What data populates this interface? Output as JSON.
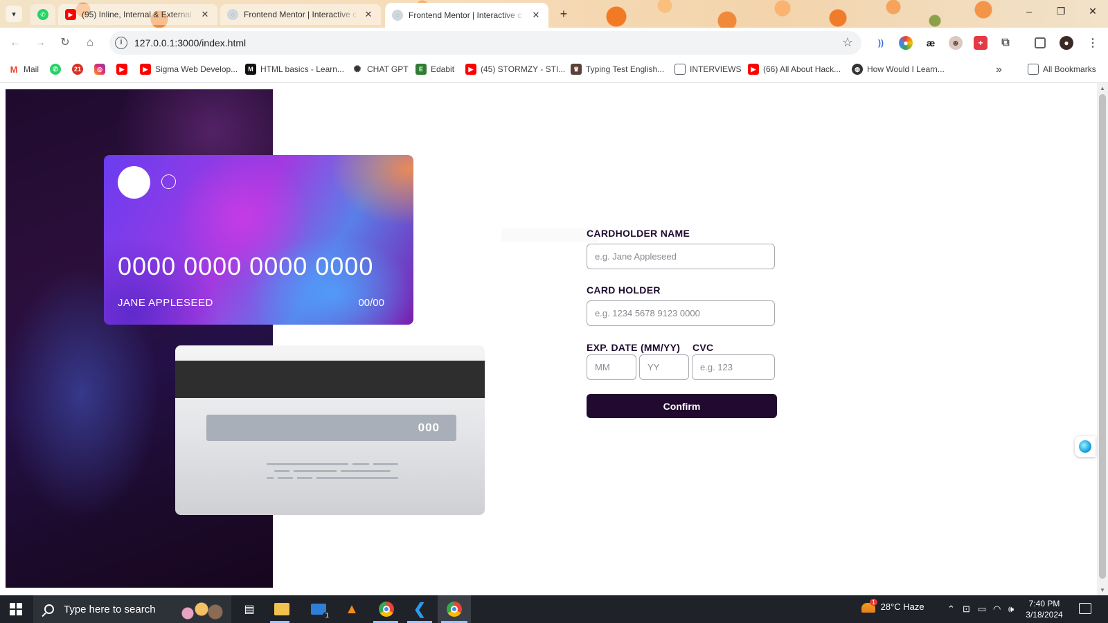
{
  "browser": {
    "tabs": [
      {
        "title": "(95) Inline, Internal & External C",
        "favicon": "youtube-icon",
        "active": false
      },
      {
        "title": "Frontend Mentor | Interactive c",
        "favicon": "page-icon",
        "active": false
      },
      {
        "title": "Frontend Mentor | Interactive c",
        "favicon": "page-icon",
        "active": true
      }
    ],
    "pinned_tab_icon": "whatsapp-icon",
    "new_tab_label": "+",
    "window_controls": {
      "minimize": "–",
      "restore": "❐",
      "close": "✕"
    },
    "url": "127.0.0.1:3000/index.html",
    "bookmarks": [
      {
        "label": "Mail",
        "icon": "gmail-icon",
        "color": "#ea4335"
      },
      {
        "label": "",
        "icon": "whatsapp-icon",
        "color": "#25d366"
      },
      {
        "label": "",
        "icon": "app-icon",
        "color": "#d93025"
      },
      {
        "label": "",
        "icon": "instagram-icon",
        "color": "#c13584"
      },
      {
        "label": "",
        "icon": "youtube-icon",
        "color": "#ff0000"
      },
      {
        "label": "Sigma Web Develop...",
        "icon": "youtube-icon",
        "color": "#ff0000"
      },
      {
        "label": "HTML basics - Learn...",
        "icon": "mdn-icon",
        "color": "#111111"
      },
      {
        "label": "CHAT GPT",
        "icon": "openai-icon",
        "color": "#333333"
      },
      {
        "label": "Edabit",
        "icon": "edabit-icon",
        "color": "#2e7d32"
      },
      {
        "label": "(45) STORMZY - STI...",
        "icon": "youtube-icon",
        "color": "#ff0000"
      },
      {
        "label": "Typing Test English...",
        "icon": "typing-icon",
        "color": "#5d4037"
      },
      {
        "label": "INTERVIEWS",
        "icon": "folder-icon",
        "color": "#5f6368"
      },
      {
        "label": "(66) All About Hack...",
        "icon": "youtube-icon",
        "color": "#ff0000"
      },
      {
        "label": "How Would I Learn...",
        "icon": "globe-icon",
        "color": "#333333"
      }
    ],
    "more_bookmarks": "»",
    "all_bookmarks": "All Bookmarks"
  },
  "card_front": {
    "number": "0000 0000 0000 0000",
    "holder": "JANE APPLESEED",
    "expiry": "00/00"
  },
  "card_back": {
    "cvc": "000"
  },
  "form": {
    "cardholder_label": "CARDHOLDER NAME",
    "cardholder_placeholder": "e.g. Jane Appleseed",
    "number_label": "CARD HOLDER",
    "number_placeholder": "e.g. 1234 5678 9123 0000",
    "exp_label": "EXP. DATE (MM/YY)",
    "mm_placeholder": "MM",
    "yy_placeholder": "YY",
    "cvc_label": "CVC",
    "cvc_placeholder": "e.g. 123",
    "confirm_label": "Confirm"
  },
  "colors": {
    "button_bg": "#21092f",
    "label": "#1e0b2e"
  },
  "taskbar": {
    "search_placeholder": "Type here to search",
    "weather": "28°C  Haze",
    "weather_badge": "1",
    "mail_badge": "1",
    "time": "7:40 PM",
    "date": "3/18/2024"
  }
}
